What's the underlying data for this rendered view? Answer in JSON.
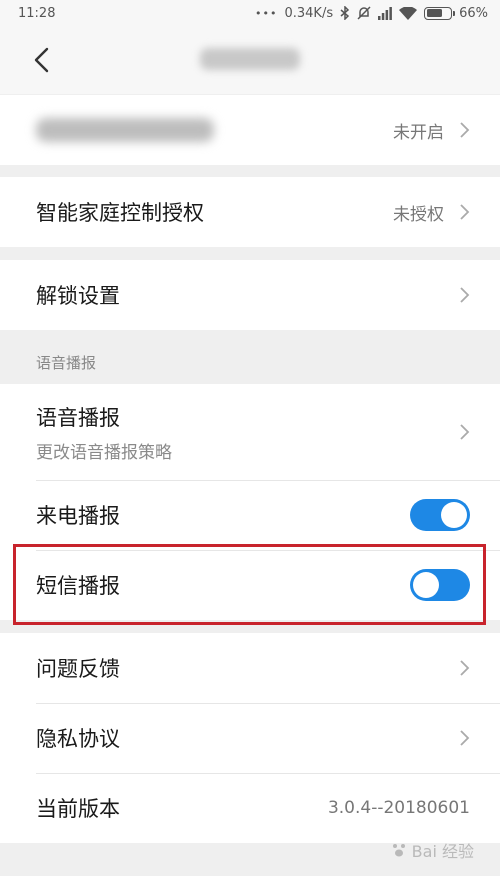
{
  "status_bar": {
    "time": "11:28",
    "more": "•••",
    "network_speed": "0.34K/s",
    "battery_percent": "66%",
    "battery_level": 0.66,
    "icons": [
      "bluetooth-icon",
      "mute-alarm-icon",
      "signal-icon",
      "wifi-icon",
      "battery-icon"
    ]
  },
  "header": {
    "back_icon": "chevron-left-icon"
  },
  "groups": {
    "first": {
      "value": "未开启"
    },
    "smart_home": {
      "label": "智能家庭控制授权",
      "value": "未授权"
    },
    "unlock": {
      "label": "解锁设置"
    },
    "voice_section": {
      "title": "语音播报",
      "voice_broadcast": {
        "label": "语音播报",
        "sublabel": "更改语音播报策略"
      },
      "call_broadcast": {
        "label": "来电播报",
        "enabled": true
      },
      "sms_broadcast": {
        "label": "短信播报",
        "enabled": false
      }
    },
    "misc": {
      "feedback": {
        "label": "问题反馈"
      },
      "privacy": {
        "label": "隐私协议"
      },
      "version": {
        "label": "当前版本",
        "value": "3.0.4--20180601"
      }
    }
  },
  "watermark": "Bai 经验",
  "colors": {
    "accent": "#1e88e5",
    "highlight": "#c8232c"
  }
}
